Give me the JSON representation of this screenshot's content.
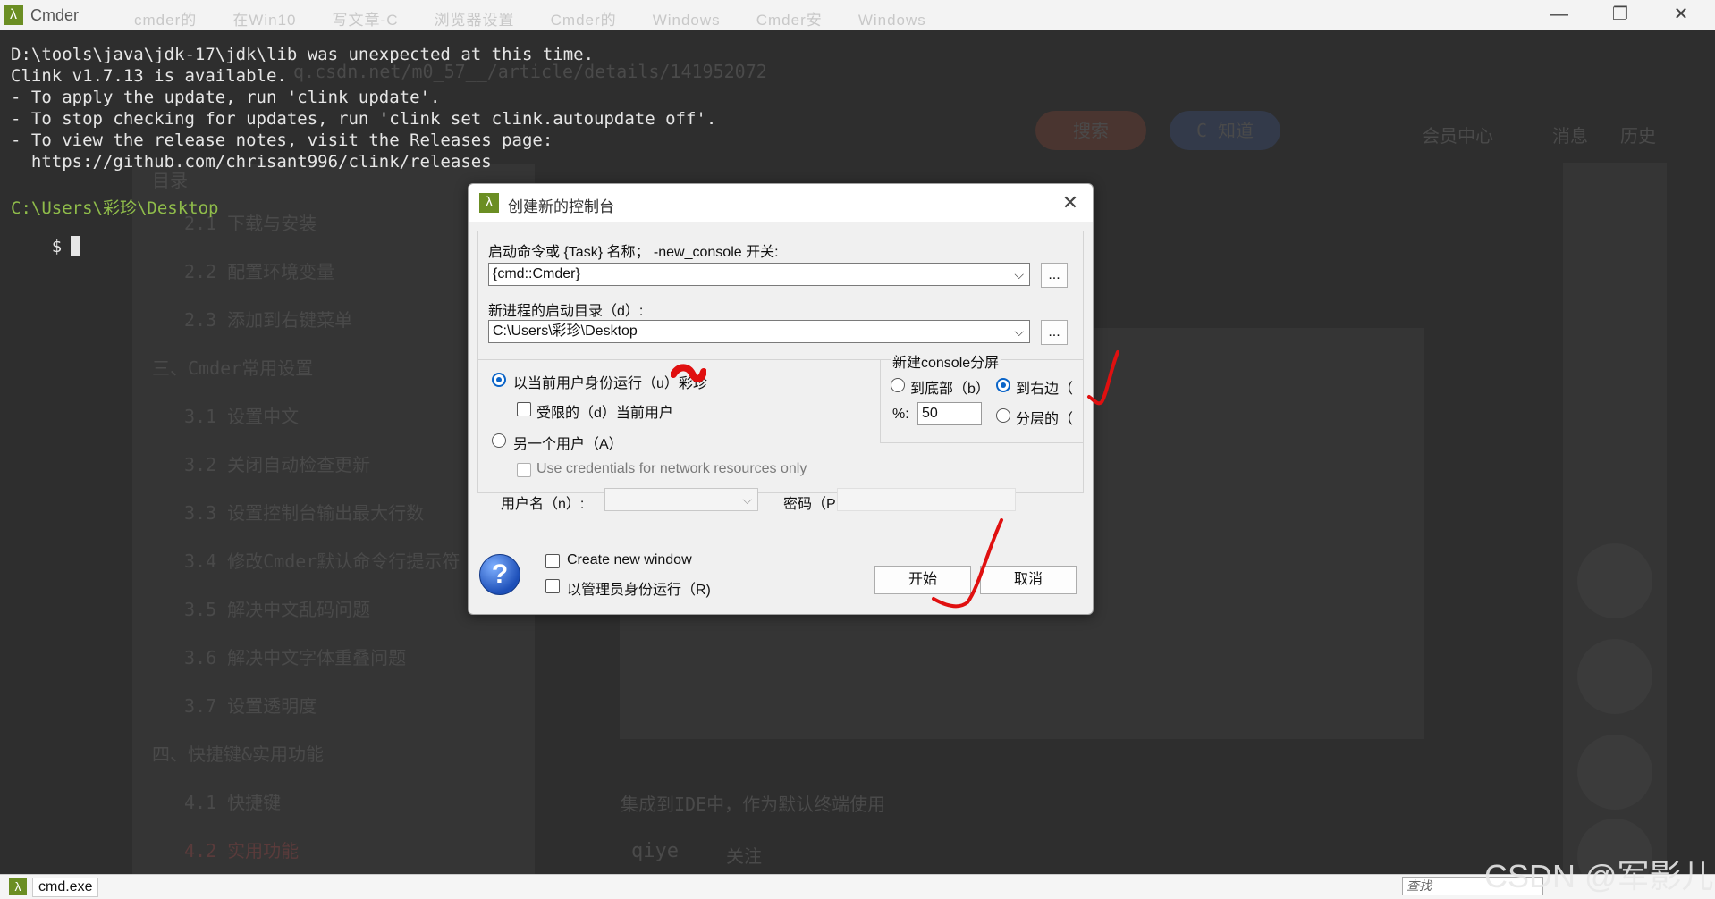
{
  "window": {
    "title": "Cmder",
    "icon": "lambda-icon",
    "background_tabs": [
      "cmder的",
      "在Win10",
      "写文章-C",
      "浏览器设置",
      "Cmder的",
      "Windows",
      "Cmder安",
      "Windows"
    ],
    "controls": {
      "minimize": "—",
      "maximize": "❐",
      "close": "✕"
    }
  },
  "terminal": {
    "lines": [
      "D:\\tools\\java\\jdk-17\\jdk\\lib was unexpected at this time.",
      "Clink v1.7.13 is available.",
      "- To apply the update, run 'clink update'.",
      "- To stop checking for updates, run 'clink set clink.autoupdate off'.",
      "- To view the release notes, visit the Releases page:",
      "  https://github.com/chrisant996/clink/releases"
    ],
    "prompt_path": "C:\\Users\\彩珍\\Desktop",
    "prompt_symbol": "$",
    "colors": {
      "background": "#2e2e2e",
      "text": "#e6e6e6",
      "path": "#8fbc4a"
    }
  },
  "background_page": {
    "url_fragment": "q.csdn.net/m0_57__/article/details/141952072",
    "toc_heading": "目录",
    "toc": [
      "2.1 下载与安装",
      "2.2 配置环境变量",
      "2.3 添加到右键菜单",
      "三、Cmder常用设置",
      "3.1 设置中文",
      "3.2 关闭自动检查更新",
      "3.3 设置控制台输出最大行数",
      "3.4 修改Cmder默认命令行提示符",
      "3.5 解决中文乱码问题",
      "3.6 解决中文字体重叠问题",
      "3.7 设置透明度",
      "四、快捷键&实用功能",
      "4.1 快捷键",
      "4.2 实用功能"
    ],
    "nav": [
      "会员中心",
      "消息",
      "历史"
    ],
    "search_button": "搜索",
    "zhidao_button": "C 知道",
    "bottom_text": "集成到IDE中，作为默认终端使用",
    "author": "qiye",
    "follow": "关注"
  },
  "dialog": {
    "title": "创建新的控制台",
    "command_label": "启动命令或 {Task} 名称； -new_console 开关:",
    "command_value": "{cmd::Cmder}",
    "dir_label": "新进程的启动目录（d）:",
    "dir_value": "C:\\Users\\彩珍\\Desktop",
    "browse_label": "...",
    "run_as_current": "以当前用户身份运行（u）",
    "run_as_current_suffix": "彩珍",
    "restricted": "受限的（d）当前用户",
    "another_user": "另一个用户（A）",
    "use_credentials": "Use credentials for network resources only",
    "username_label": "用户名（n）:",
    "password_label": "密码（P",
    "split_group_label": "新建console分屏",
    "split_bottom": "到底部（b）",
    "split_right": "到右边（",
    "percent_label": "%:",
    "percent_value": "50",
    "split_layered": "分层的（",
    "create_new_window": "Create new window",
    "run_as_admin": "以管理员身份运行（R)",
    "start_button": "开始",
    "cancel_button": "取消",
    "help_icon": "question-icon"
  },
  "statusbar": {
    "tab_label": "cmd.exe",
    "search_placeholder": "查找"
  },
  "watermark": "CSDN @军影儿"
}
